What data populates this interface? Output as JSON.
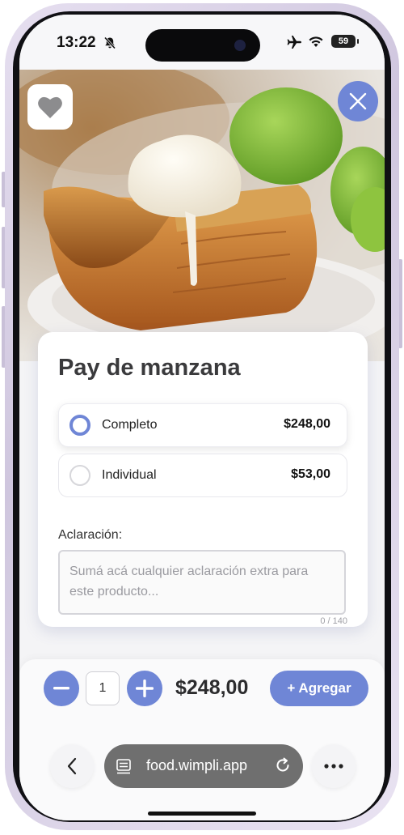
{
  "status_bar": {
    "time": "13:22",
    "battery": "59",
    "icons": [
      "bell-slash-icon",
      "airplane-icon",
      "wifi-icon",
      "battery-icon"
    ]
  },
  "hero": {
    "favorite_icon": "heart-icon",
    "close_icon": "close-icon"
  },
  "product": {
    "title": "Pay de manzana",
    "options": [
      {
        "label": "Completo",
        "price": "$248,00",
        "selected": true
      },
      {
        "label": "Individual",
        "price": "$53,00",
        "selected": false
      }
    ],
    "note_label": "Aclaración:",
    "note_placeholder": "Sumá acá cualquier aclaración extra para este producto...",
    "note_counter": "0 / 140"
  },
  "cart": {
    "quantity": "1",
    "total": "$248,00",
    "add_label": "+ Agregar"
  },
  "browser": {
    "url": "food.wimpli.app"
  },
  "colors": {
    "accent": "#6f86d6",
    "url_bar": "#6f6f6f"
  }
}
